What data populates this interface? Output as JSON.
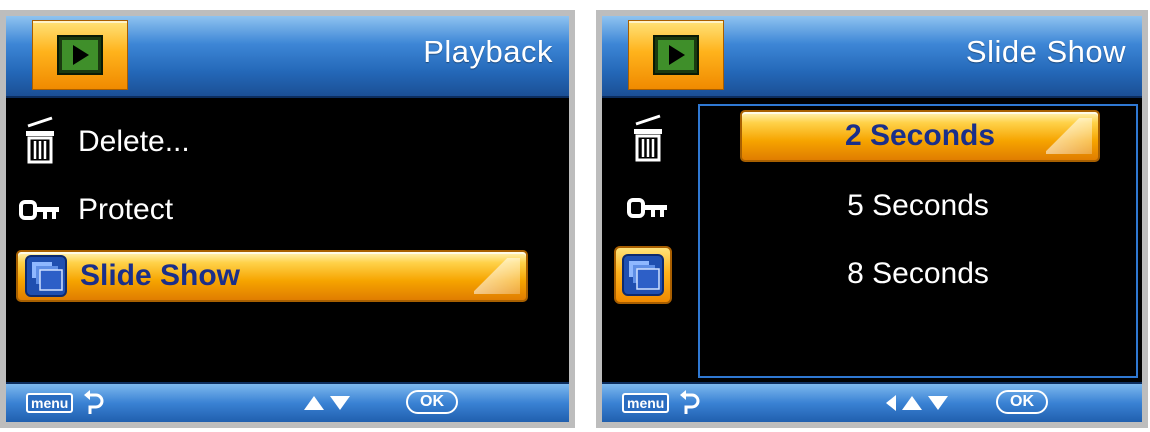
{
  "left_screen": {
    "title": "Playback",
    "menu_items": [
      {
        "label": "Delete...",
        "icon": "trash-icon",
        "selected": false
      },
      {
        "label": "Protect",
        "icon": "key-icon",
        "selected": false
      },
      {
        "label": "Slide Show",
        "icon": "slideshow-icon",
        "selected": true
      }
    ],
    "footer": {
      "menu_key": "menu",
      "ok_key": "OK"
    }
  },
  "right_screen": {
    "title": "Slide Show",
    "side_icons": [
      "trash-icon",
      "key-icon",
      "slideshow-icon"
    ],
    "options": [
      {
        "label": "2 Seconds",
        "selected": true
      },
      {
        "label": "5 Seconds",
        "selected": false
      },
      {
        "label": "8 Seconds",
        "selected": false
      }
    ],
    "footer": {
      "menu_key": "menu",
      "ok_key": "OK"
    }
  },
  "colors": {
    "header_blue": "#2468b8",
    "highlight_orange": "#f6a400",
    "selected_text": "#1a2f8a",
    "submenu_border": "#2f78d2"
  }
}
